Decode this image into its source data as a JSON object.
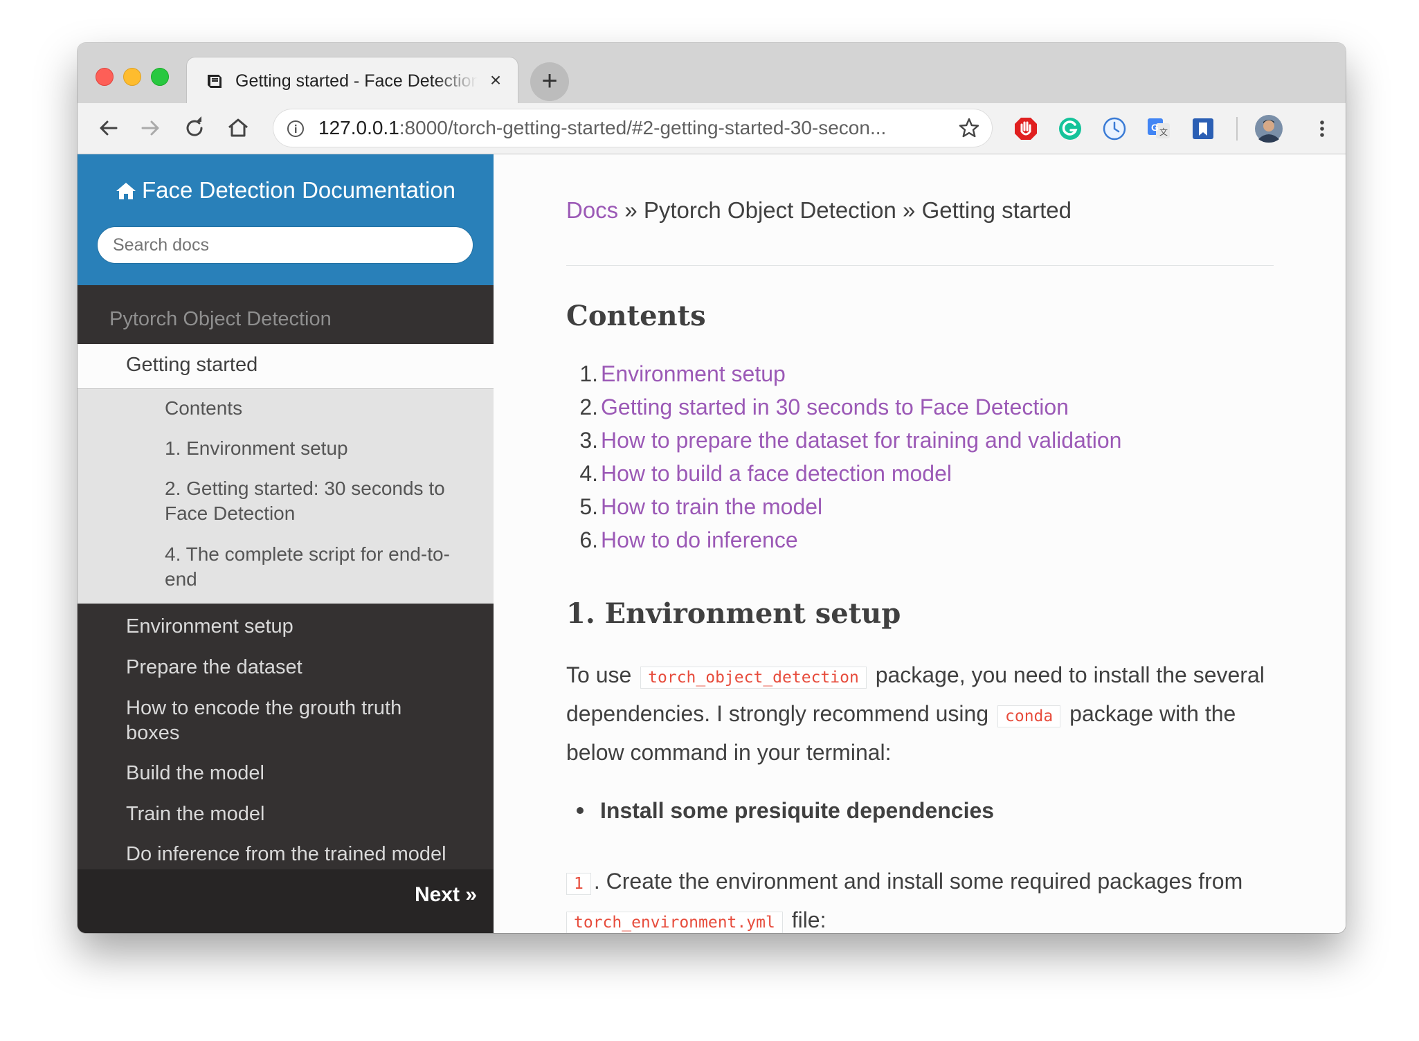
{
  "browser": {
    "tab_title": "Getting started - Face Detection",
    "tab_close": "×",
    "new_tab": "+",
    "url_host": "127.0.0.1",
    "url_path": ":8000/torch-getting-started/#2-getting-started-30-secon..."
  },
  "sidebar": {
    "brand": "Face Detection Documentation",
    "search_placeholder": "Search docs",
    "caption": "Pytorch Object Detection",
    "current": "Getting started",
    "subitems": [
      "Contents",
      "1. Environment setup",
      "2. Getting started: 30 seconds to Face Detection",
      "4. The complete script for end-to-end"
    ],
    "items": [
      "Environment setup",
      "Prepare the dataset",
      "How to encode the grouth truth boxes",
      "Build the model",
      "Train the model",
      "Do inference from the trained model"
    ],
    "next": "Next »"
  },
  "content": {
    "breadcrumb": {
      "docs": "Docs",
      "rest": " » Pytorch Object Detection » Getting started"
    },
    "contents_heading": "Contents",
    "toc": [
      {
        "num": "1.",
        "text": "Environment setup"
      },
      {
        "num": "2.",
        "text": "Getting started in 30 seconds to Face Detection"
      },
      {
        "num": "3.",
        "text": "How to prepare the dataset for training and validation"
      },
      {
        "num": "4.",
        "text": "How to build a face detection model"
      },
      {
        "num": "5.",
        "text": "How to train the model"
      },
      {
        "num": "6.",
        "text": "How to do inference"
      }
    ],
    "section_heading": "1. Environment setup",
    "para1": {
      "a": "To use",
      "code1": "torch_object_detection",
      "b": "package, you need to install the several dependencies. I strongly recommend using",
      "code2": "conda",
      "c": "package with the below command in your terminal:"
    },
    "bullet": "Install some presiquite dependencies",
    "para2": {
      "code1": "1",
      "a": ". Create the environment and install some required packages from",
      "code2": "torch_environment.yml",
      "b": "file:"
    }
  },
  "colors": {
    "link": "#9b59b6",
    "sidebar_header": "#2980b9",
    "sidebar_bg": "#343131",
    "code_text": "#e74c3c"
  }
}
